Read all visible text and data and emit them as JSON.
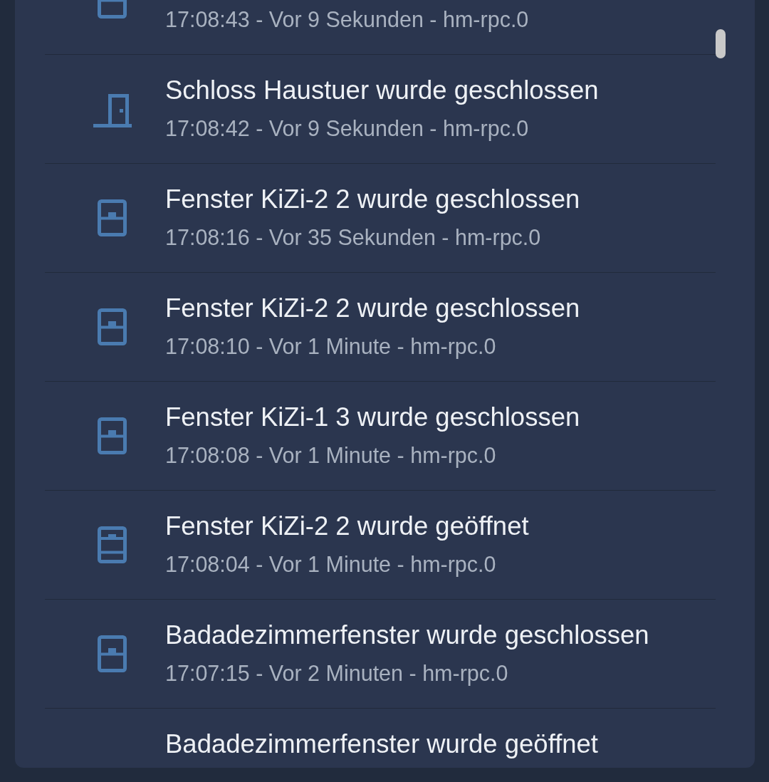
{
  "event_list": {
    "items": [
      {
        "kind": "window_closed",
        "details": "17:08:43 - Vor 9 Sekunden - hm-rpc.0"
      },
      {
        "kind": "door",
        "title": "Schloss Haustuer wurde geschlossen",
        "details": "17:08:42 - Vor 9 Sekunden - hm-rpc.0"
      },
      {
        "kind": "window_closed",
        "title": "Fenster KiZi-2 2 wurde geschlossen",
        "details": "17:08:16 - Vor 35 Sekunden - hm-rpc.0"
      },
      {
        "kind": "window_closed",
        "title": "Fenster KiZi-2 2 wurde geschlossen",
        "details": "17:08:10 - Vor 1 Minute - hm-rpc.0"
      },
      {
        "kind": "window_closed",
        "title": "Fenster KiZi-1 3 wurde geschlossen",
        "details": "17:08:08 - Vor 1 Minute - hm-rpc.0"
      },
      {
        "kind": "window_open",
        "title": "Fenster KiZi-2 2 wurde geöffnet",
        "details": "17:08:04 - Vor 1 Minute - hm-rpc.0"
      },
      {
        "kind": "window_closed",
        "title": "Badadezimmerfenster wurde geschlossen",
        "details": "17:07:15 - Vor 2 Minuten - hm-rpc.0"
      },
      {
        "title": "Badadezimmerfenster wurde geöffnet"
      }
    ]
  }
}
